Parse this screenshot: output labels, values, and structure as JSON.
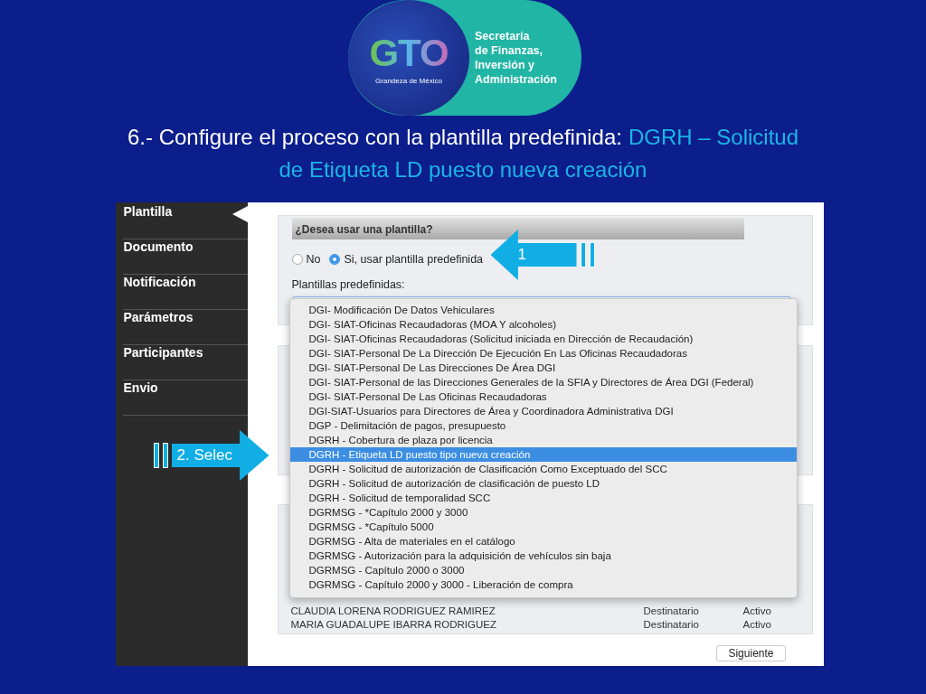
{
  "logo": {
    "mark": "GTO",
    "tagline": "Grandeza de México",
    "lines": [
      "Secretaría",
      "de Finanzas,",
      "Inversión y",
      "Administración"
    ]
  },
  "title": {
    "text": "6.- Configure el proceso con la plantilla predefinida:",
    "template": [
      "DGRH – Solicitud",
      "de Etiqueta LD puesto nueva creación"
    ]
  },
  "sidebar": {
    "items": [
      {
        "label": "Plantilla",
        "selected": true
      },
      {
        "label": "Documento",
        "selected": false
      },
      {
        "label": "Notificación",
        "selected": false
      },
      {
        "label": "Parámetros",
        "selected": false
      },
      {
        "label": "Participantes",
        "selected": false
      },
      {
        "label": "Envio",
        "selected": false
      }
    ]
  },
  "panel": {
    "header": "¿Desea usar una plantilla?",
    "radios": [
      {
        "label": "No",
        "selected": false
      },
      {
        "label": "Si, usar plantilla predefinida",
        "selected": true
      }
    ],
    "field_label": "Plantillas predefinidas:"
  },
  "dropdown": {
    "options": [
      {
        "label": "DGI- Modificación De Datos Vehiculares",
        "selected": false
      },
      {
        "label": "DGI- SIAT-Oficinas Recaudadoras (MOA Y alcoholes)",
        "selected": false
      },
      {
        "label": "DGI- SIAT-Oficinas Recaudadoras (Solicitud iniciada en Dirección de Recaudación)",
        "selected": false
      },
      {
        "label": "DGI- SIAT-Personal De La Dirección De Ejecución En Las Oficinas Recaudadoras",
        "selected": false
      },
      {
        "label": "DGI- SIAT-Personal De Las Direcciones De Área DGI",
        "selected": false
      },
      {
        "label": "DGI- SIAT-Personal de las Direcciones Generales de la SFIA y Directores de Área DGI (Federal)",
        "selected": false
      },
      {
        "label": "DGI- SIAT-Personal De Las Oficinas Recaudadoras",
        "selected": false
      },
      {
        "label": "DGI-SIAT-Usuarios para Directores de Área y Coordinadora Administrativa DGI",
        "selected": false
      },
      {
        "label": "DGP - Delimitación de pagos, presupuesto",
        "selected": false
      },
      {
        "label": "DGRH - Cobertura de plaza por licencia",
        "selected": false
      },
      {
        "label": "DGRH - Etiqueta LD puesto tipo nueva creación",
        "selected": true
      },
      {
        "label": "DGRH - Solicitud de autorización de Clasificación Como Exceptuado del SCC",
        "selected": false
      },
      {
        "label": "DGRH - Solicitud de autorización de clasificación de puesto LD",
        "selected": false
      },
      {
        "label": "DGRH - Solicitud de temporalidad SCC",
        "selected": false
      },
      {
        "label": "DGRMSG - *Capítulo 2000 y 3000",
        "selected": false
      },
      {
        "label": "DGRMSG - *Capítulo 5000",
        "selected": false
      },
      {
        "label": "DGRMSG - Alta de materiales en el catálogo",
        "selected": false
      },
      {
        "label": "DGRMSG - Autorización para la adquisición de vehículos sin baja",
        "selected": false
      },
      {
        "label": "DGRMSG - Capítulo 2000 o 3000",
        "selected": false
      },
      {
        "label": "DGRMSG - Capítulo 2000 y 3000 - Liberación de compra",
        "selected": false
      }
    ]
  },
  "participants": [
    {
      "name": "CLAUDIA LORENA RODRIGUEZ RAMIREZ",
      "role": "Destinatario",
      "status": "Activo"
    },
    {
      "name": "MARIA GUADALUPE IBARRA RODRIGUEZ",
      "role": "Destinatario",
      "status": "Activo"
    }
  ],
  "next_button": "Siguiente",
  "callouts": [
    {
      "label": "1"
    },
    {
      "label": "2. Selec"
    }
  ]
}
